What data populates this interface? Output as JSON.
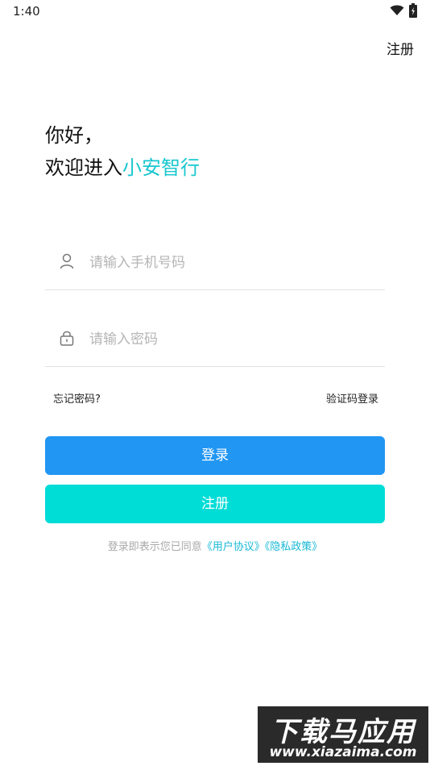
{
  "status_bar": {
    "time": "1:40",
    "icons": [
      "wifi-icon",
      "battery-icon"
    ]
  },
  "header": {
    "register_label": "注册"
  },
  "greeting": {
    "line1": "你好，",
    "line2_prefix": "欢迎进入",
    "brand_name": "小安智行"
  },
  "form": {
    "phone": {
      "placeholder": "请输入手机号码",
      "value": "",
      "icon": "user-icon"
    },
    "password": {
      "placeholder": "请输入密码",
      "value": "",
      "icon": "lock-icon"
    },
    "forgot_label": "忘记密码?",
    "code_login_label": "验证码登录"
  },
  "buttons": {
    "login_label": "登录",
    "register_label": "注册"
  },
  "agreement": {
    "prefix": "登录即表示您已同意",
    "user_agreement": "《用户协议》",
    "privacy_policy": "《隐私政策》"
  },
  "watermark": {
    "title": "下载马应用",
    "url": "www.xiazaima.com"
  },
  "colors": {
    "brand": "#18c7cf",
    "login_button": "#2196f3",
    "register_button": "#00dcd6",
    "link": "#18b9d6"
  }
}
